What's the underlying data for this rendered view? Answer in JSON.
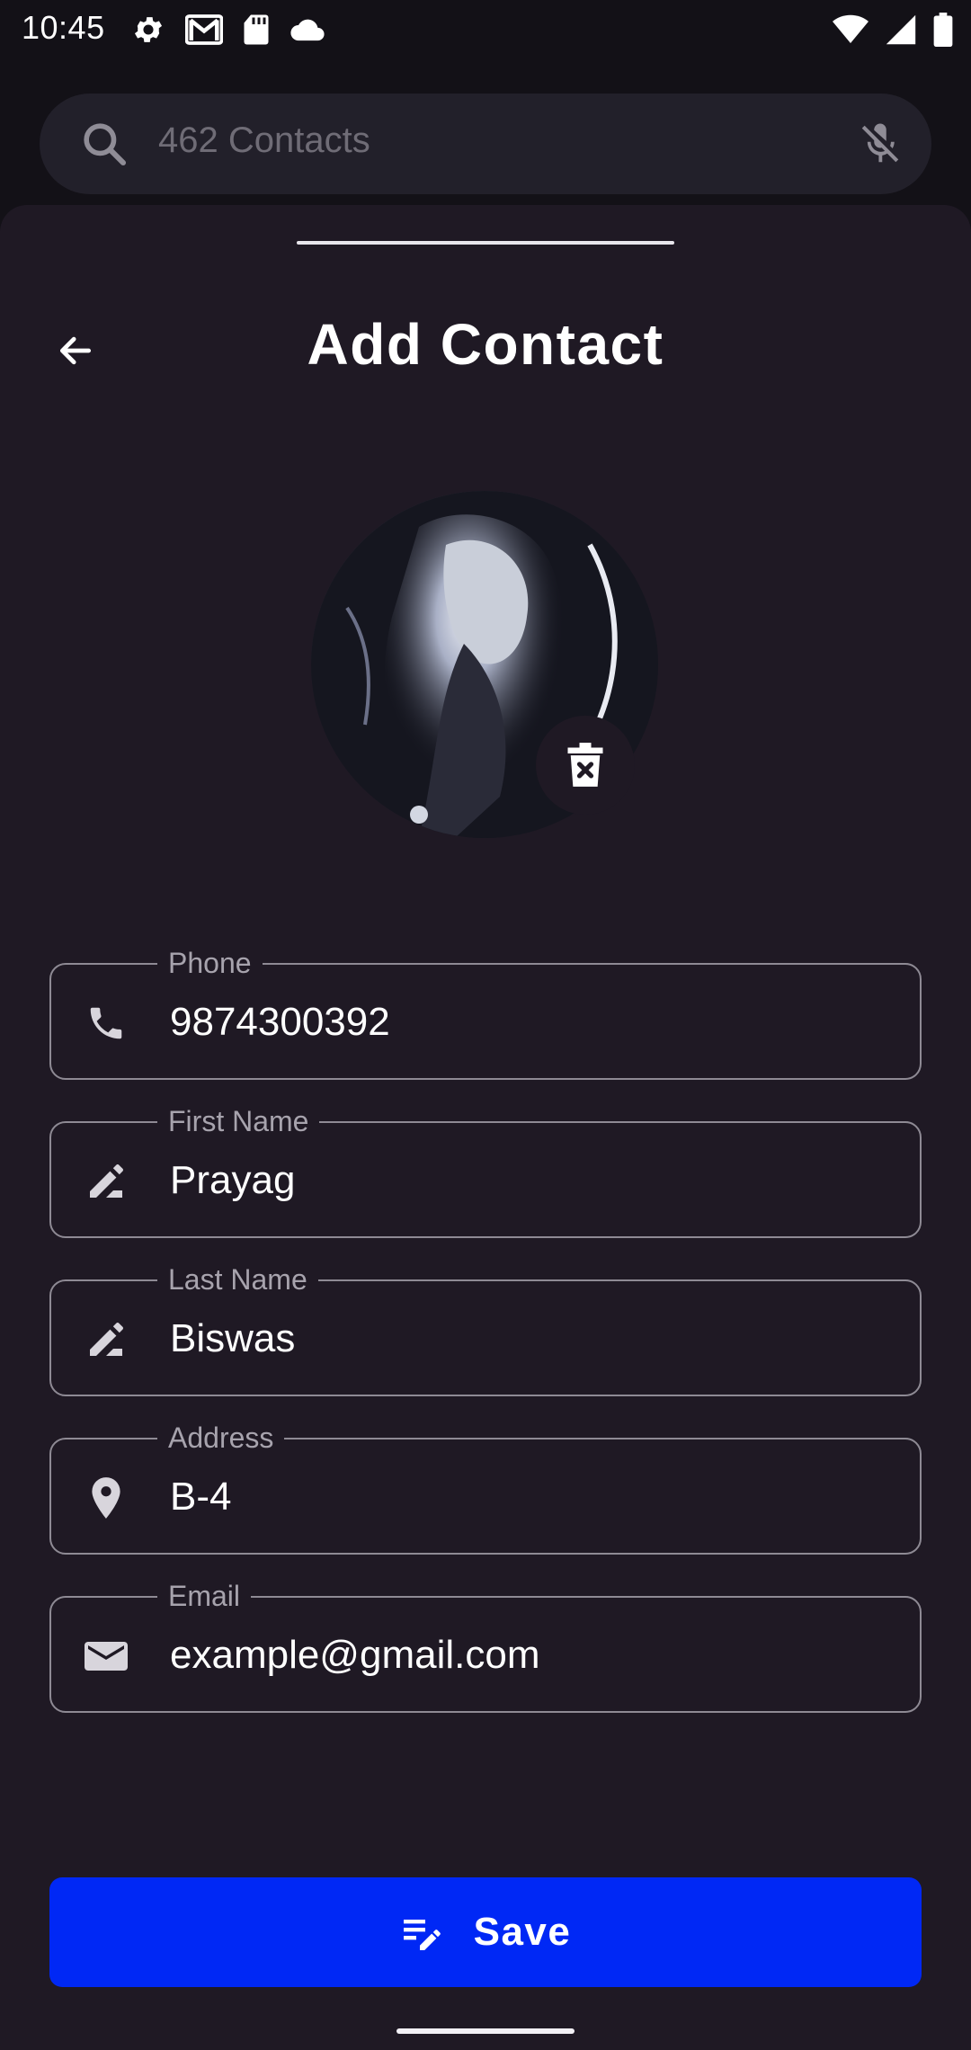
{
  "status_bar": {
    "time": "10:45"
  },
  "search": {
    "placeholder": "462 Contacts"
  },
  "sheet": {
    "title": "Add Contact"
  },
  "fields": {
    "phone": {
      "label": "Phone",
      "value": "9874300392",
      "icon": "phone-icon"
    },
    "first_name": {
      "label": "First Name",
      "value": "Prayag",
      "icon": "edit-icon"
    },
    "last_name": {
      "label": "Last Name",
      "value": "Biswas",
      "icon": "edit-icon"
    },
    "address": {
      "label": "Address",
      "value": "B-4",
      "icon": "location-pin-icon"
    },
    "email": {
      "label": "Email",
      "value": "example@gmail.com",
      "icon": "mail-icon"
    }
  },
  "save_button": {
    "label": "Save",
    "icon": "edit-note-icon"
  },
  "colors": {
    "accent": "#0028f5",
    "sheet_background": "#1f1924",
    "outline": "#8e8a94"
  }
}
